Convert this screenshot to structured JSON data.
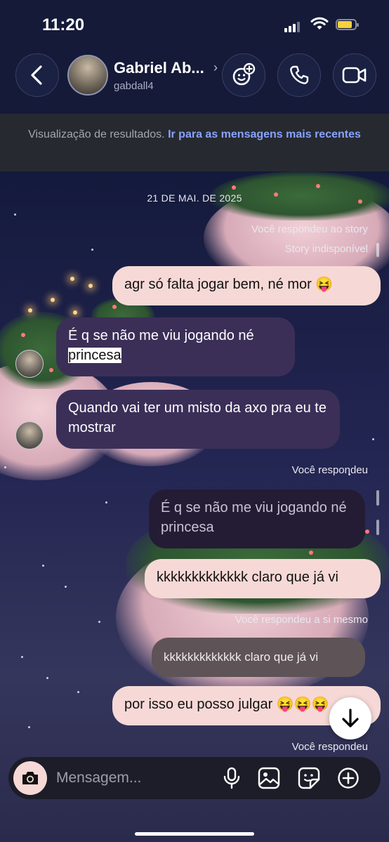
{
  "status_bar": {
    "time": "11:20"
  },
  "header": {
    "contact_name": "Gabriel Ab...",
    "contact_handle": "gabdall4"
  },
  "banner": {
    "text": "Visualização de resultados.",
    "link": "Ir para as mensagens mais recentes"
  },
  "thread": {
    "date": "21 DE MAI. DE 2025",
    "story_reply_label": "Você respondeu ao story",
    "story_unavailable": "Story indisponível",
    "msg1": "agr só falta jogar bem, né mor 😝",
    "msg2_text": "É q se não me viu jogando né",
    "msg2_highlight": "princesa",
    "msg3": "Quando vai ter um misto da axo pra eu te mostrar",
    "reply_label_1": "Você respondeu",
    "quote1": "É q se não me viu jogando né princesa",
    "msg4": "kkkkkkkkkkkkk claro que já vi",
    "reply_label_2": "Você respondeu a si mesmo",
    "quote2": "kkkkkkkkkkkkk claro que já vi",
    "msg5": "por isso eu posso julgar 😝😝😝",
    "reply_label_3": "Você respondeu"
  },
  "composer": {
    "placeholder": "Mensagem..."
  },
  "colors": {
    "sent_bubble": "#f6d9d6",
    "received_bubble": "#3b2f58",
    "link": "#8aa2ff",
    "header_bg": "#151a38"
  },
  "icons": [
    "back-arrow-icon",
    "sticker-plus-icon",
    "phone-icon",
    "video-camera-icon",
    "arrow-down-icon",
    "camera-icon",
    "microphone-icon",
    "image-icon",
    "sticker-icon",
    "plus-circle-icon"
  ]
}
